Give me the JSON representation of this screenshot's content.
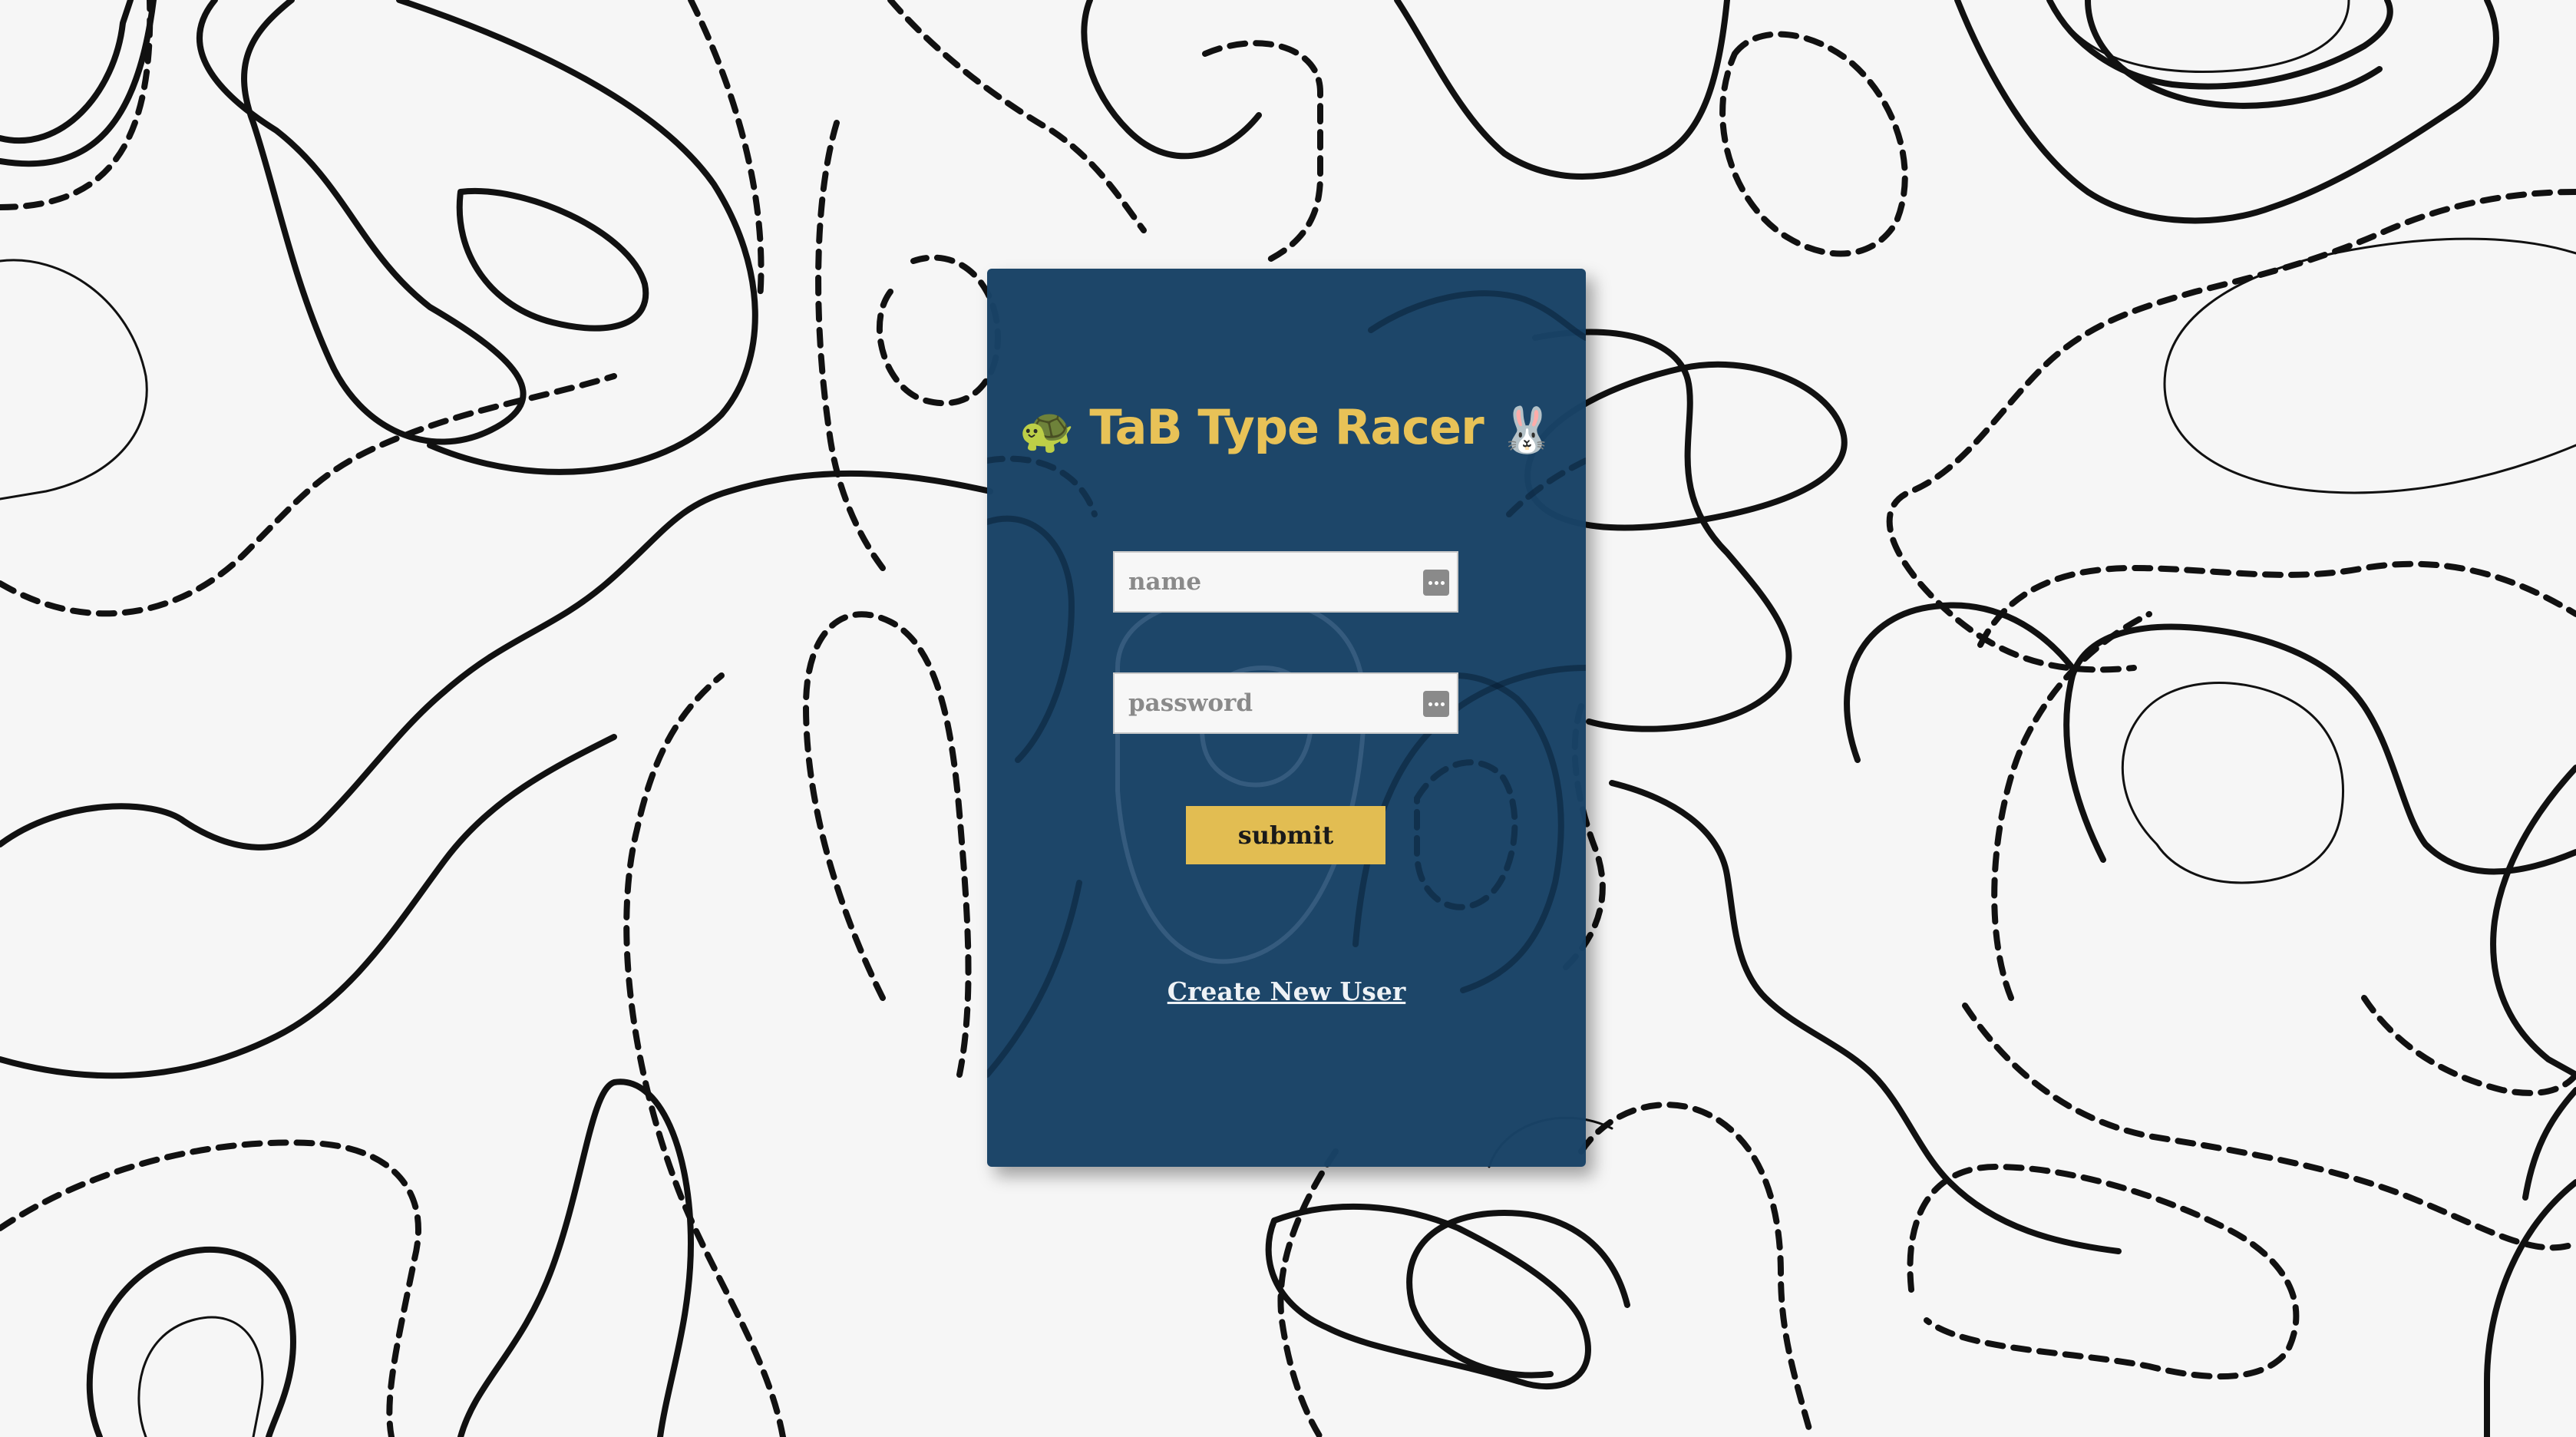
{
  "app": {
    "title": "TaB Type Racer",
    "title_left_icon": "turtle-icon",
    "title_right_icon": "rabbit-icon",
    "title_left_glyph": "🐢",
    "title_right_glyph": "🐰"
  },
  "form": {
    "name_placeholder": "name",
    "name_value": "",
    "password_placeholder": "password",
    "password_value": "",
    "field_icon": "password-manager-key-icon",
    "submit_label": "submit"
  },
  "links": {
    "create_user_label": "Create New User"
  },
  "colors": {
    "card_background": "#184266",
    "title": "#e8c257",
    "submit_background": "#e2bd52",
    "page_background": "#f6f6f6",
    "link": "#eef2f6"
  }
}
